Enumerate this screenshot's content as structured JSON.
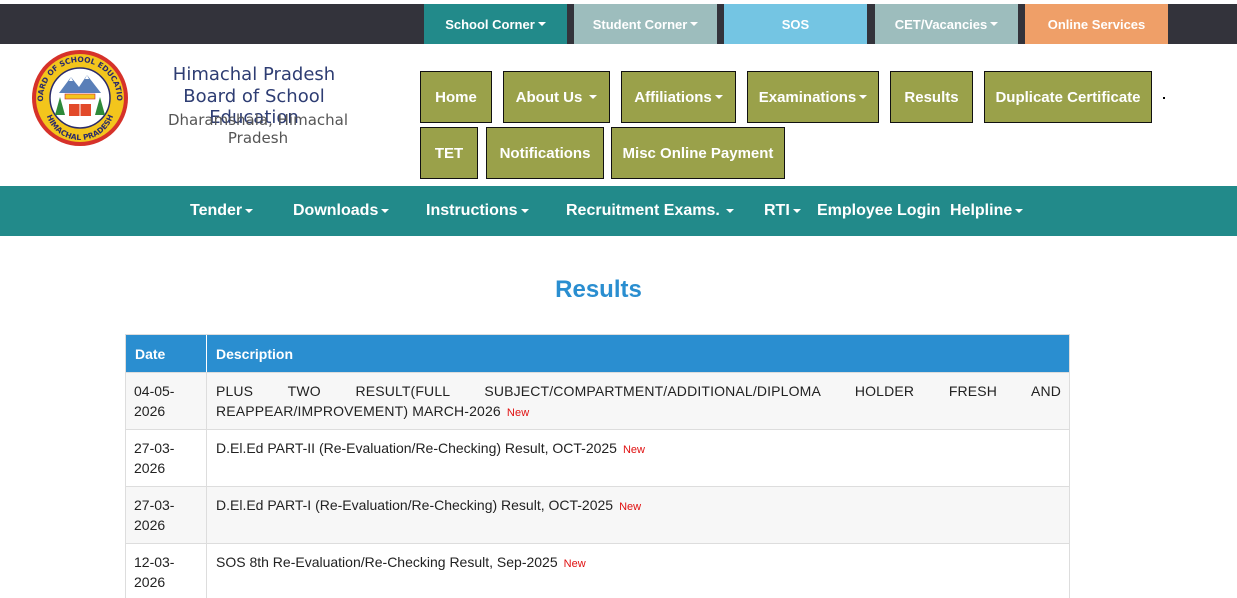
{
  "top_nav": [
    {
      "label": "School Corner",
      "dropdown": true,
      "color": "#228a8a"
    },
    {
      "label": "Student Corner",
      "dropdown": true,
      "color": "#9dbdbd"
    },
    {
      "label": "SOS",
      "dropdown": false,
      "color": "#74c5e3"
    },
    {
      "label": "CET/Vacancies",
      "dropdown": true,
      "color": "#9dbdbd"
    },
    {
      "label": "Online Services",
      "dropdown": false,
      "color": "#ef9f68"
    }
  ],
  "header": {
    "logo_text_top": "BOARD OF SCHOOL EDUCATION",
    "logo_text_bottom": "HIMACHAL PRADESH",
    "line1": "Himachal Pradesh",
    "line2": "Board of School Education",
    "line3": "Dharamshala, Himachal Pradesh"
  },
  "main_nav": [
    {
      "label": "Home",
      "dropdown": false
    },
    {
      "label": "About Us",
      "dropdown": true
    },
    {
      "label": "Affiliations",
      "dropdown": true
    },
    {
      "label": "Examinations",
      "dropdown": true
    },
    {
      "label": "Results",
      "dropdown": false
    },
    {
      "label": "Duplicate Certificate",
      "dropdown": false
    },
    {
      "label": "TET",
      "dropdown": false
    },
    {
      "label": "Notifications",
      "dropdown": false
    },
    {
      "label": "Misc Online Payment",
      "dropdown": false
    }
  ],
  "secondary_nav": [
    {
      "label": "Tender",
      "dropdown": true
    },
    {
      "label": "Downloads",
      "dropdown": true
    },
    {
      "label": "Instructions",
      "dropdown": true
    },
    {
      "label": "Recruitment Exams.",
      "dropdown": true
    },
    {
      "label": "RTI",
      "dropdown": true
    },
    {
      "label": "Employee Login",
      "dropdown": false
    },
    {
      "label": "Helpline",
      "dropdown": true
    }
  ],
  "page_title": "Results",
  "table": {
    "headers": {
      "date": "Date",
      "description": "Description"
    },
    "rows": [
      {
        "date_a": "04-05-",
        "date_b": "2026",
        "description": "PLUS TWO RESULT(FULL SUBJECT/COMPARTMENT/ADDITIONAL/DIPLOMA HOLDER FRESH AND REAPPEAR/IMPROVEMENT) MARCH-2026",
        "badge": "New"
      },
      {
        "date_a": "27-03-",
        "date_b": "2026",
        "description": "D.El.Ed PART-II (Re-Evaluation/Re-Checking) Result, OCT-2025",
        "badge": "New"
      },
      {
        "date_a": "27-03-",
        "date_b": "2026",
        "description": "D.El.Ed PART-I (Re-Evaluation/Re-Checking) Result, OCT-2025",
        "badge": "New"
      },
      {
        "date_a": "12-03-",
        "date_b": "2026",
        "description": "SOS 8th Re-Evaluation/Re-Checking Result, Sep-2025",
        "badge": "New"
      }
    ]
  },
  "colors": {
    "header_bar": "#33333b",
    "olive_button": "#9aa14a",
    "teal_nav": "#228a8a",
    "table_header": "#2a8ed0",
    "title": "#2a8ed0",
    "new_badge": "#e01010"
  }
}
